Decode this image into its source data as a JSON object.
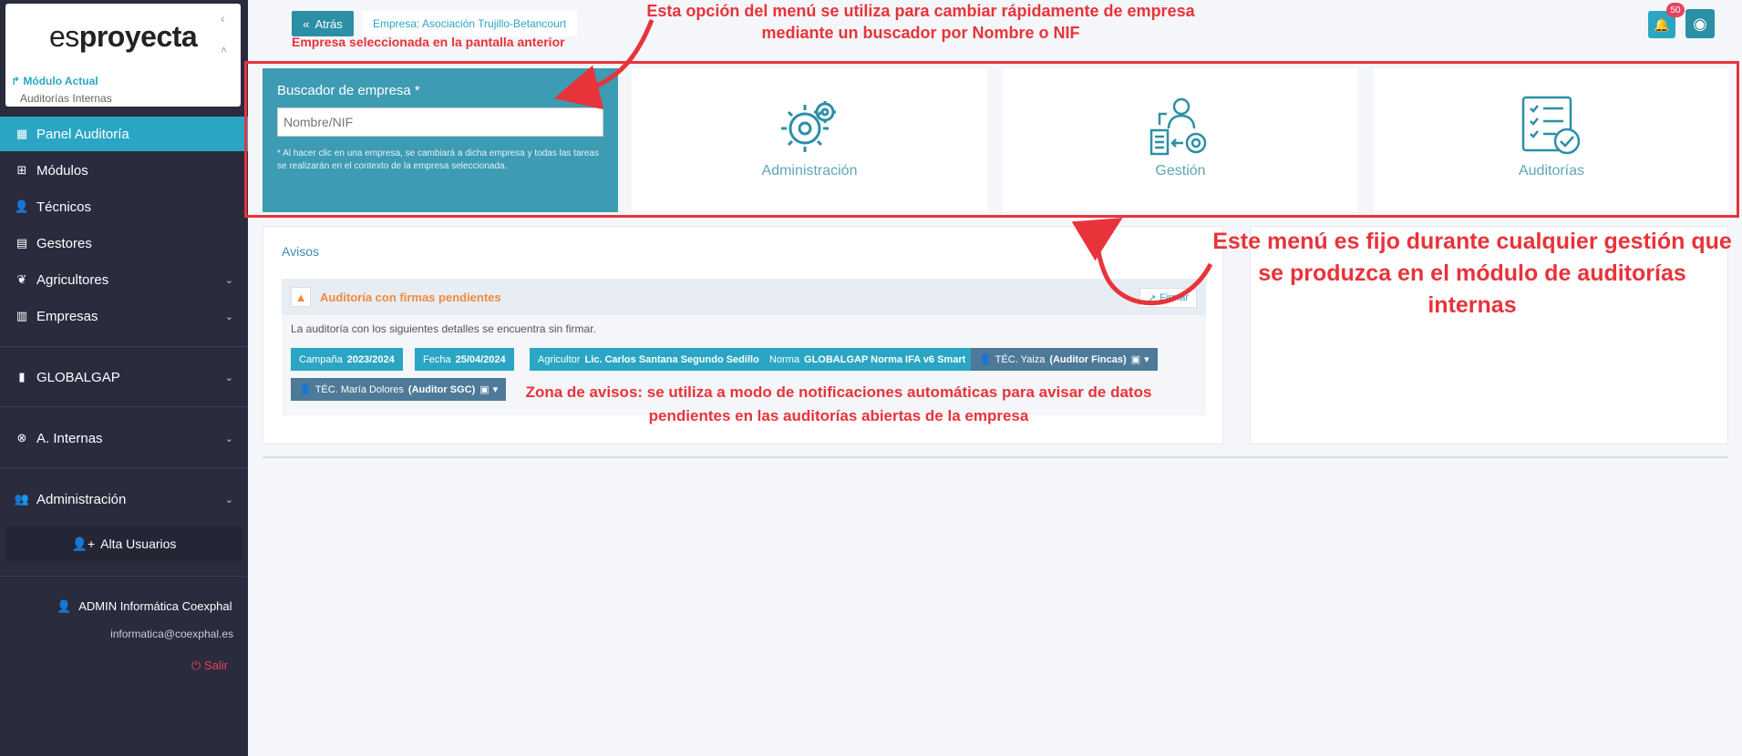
{
  "sidebar": {
    "logo_part1": "es",
    "logo_part2": "proyecta",
    "current_module_label": "Módulo Actual",
    "current_module_value": "Auditorías Internas",
    "items": [
      {
        "label": "Panel Auditoría",
        "icon": "chart-icon",
        "active": true
      },
      {
        "label": "Módulos",
        "icon": "grid-icon"
      },
      {
        "label": "Técnicos",
        "icon": "user-gear-icon"
      },
      {
        "label": "Gestores",
        "icon": "building-user-icon"
      },
      {
        "label": "Agricultores",
        "icon": "seedling-icon"
      },
      {
        "label": "Empresas",
        "icon": "building-icon"
      },
      {
        "label": "GLOBALGAP",
        "icon": "book-icon"
      },
      {
        "label": "A. Internas",
        "icon": "binoculars-icon"
      },
      {
        "label": "Administración",
        "icon": "users-gear-icon"
      }
    ],
    "alta_usuarios": "Alta Usuarios",
    "user_name": "ADMIN Informática Coexphal",
    "user_email": "informatica@coexphal.es",
    "logout": "Salir"
  },
  "header": {
    "back_label": "Atrás",
    "company_label": "Empresa: Asociación Trujillo-Betancourt",
    "notification_count": "50"
  },
  "search": {
    "label": "Buscador de empresa *",
    "placeholder": "Nombre/NIF",
    "note": "* Al hacer clic en una empresa, se cambiará a dicha empresa y todas las tareas se realizarán en el contexto de la empresa seleccionada."
  },
  "modules": [
    {
      "label": "Administración",
      "icon": "gears-icon"
    },
    {
      "label": "Gestión",
      "icon": "manager-icon"
    },
    {
      "label": "Auditorías",
      "icon": "checklist-icon"
    }
  ],
  "avisos": {
    "title": "Avisos",
    "alert_title": "Auditoría con firmas pendientes",
    "sign_button": "Firmar",
    "body": "La auditoría con los siguientes detalles se encuentra sin firmar.",
    "tags": [
      {
        "key": "Campaña",
        "value": "2023/2024"
      },
      {
        "key": "Fecha",
        "value": "25/04/2024"
      },
      {
        "key": "Agricultor",
        "value": "Lic. Carlos Santana Segundo Sedillo"
      },
      {
        "key": "Norma",
        "value": "GLOBALGAP Norma IFA v6 Smart"
      },
      {
        "key": "TÉC. Yaiza",
        "value": "(Auditor Fincas)"
      },
      {
        "key": "TÉC. María Dolores",
        "value": "(Auditor SGC)"
      }
    ]
  },
  "annotations": {
    "top": "Esta opción del menú se utiliza para cambiar rápidamente de empresa mediante un buscador por Nombre o NIF",
    "empresa": "Empresa seleccionada en la pantalla anterior",
    "right": "Este menú es fijo durante cualquier gestión que se produzca en el módulo de auditorías internas",
    "avisos": "Zona de avisos: se utiliza a modo de notificaciones automáticas para avisar de datos pendientes en las auditorías abiertas de la empresa"
  },
  "colors": {
    "sidebar_bg": "#2a2b3d",
    "accent": "#2aa6c4",
    "annotation": "#e8333a",
    "warning": "#f08a3c"
  }
}
